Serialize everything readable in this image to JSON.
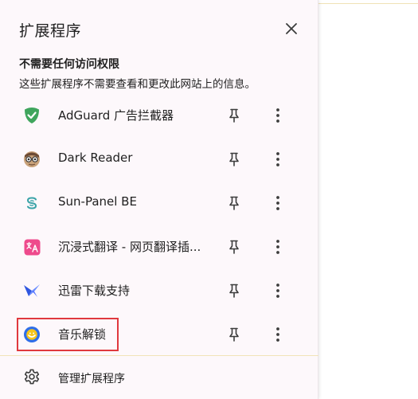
{
  "popup": {
    "title": "扩展程序",
    "section_heading": "不需要任何访问权限",
    "section_desc": "这些扩展程序不需要查看和更改此网站上的信息。",
    "extensions": [
      {
        "name": "AdGuard 广告拦截器",
        "icon": "adguard-shield-icon"
      },
      {
        "name": "Dark Reader",
        "icon": "dark-reader-icon"
      },
      {
        "name": "Sun-Panel BE",
        "icon": "sun-panel-icon"
      },
      {
        "name": "沉浸式翻译 - 网页翻译插...",
        "icon": "immersive-translate-icon"
      },
      {
        "name": "迅雷下载支持",
        "icon": "xunlei-bird-icon"
      },
      {
        "name": "音乐解锁",
        "icon": "music-unlock-icon"
      }
    ],
    "manage_label": "管理扩展程序"
  },
  "colors": {
    "popup_bg": "#fdf8fb",
    "highlight": "#e0393e",
    "adguard_green": "#3fa55d",
    "immersive_pink": "#ee4a8c",
    "sunpanel_teal": "#3aa3a8",
    "xunlei_blue": "#4b6bff",
    "music_blue": "#2f6ee8",
    "music_yellow": "#f7c51a"
  }
}
